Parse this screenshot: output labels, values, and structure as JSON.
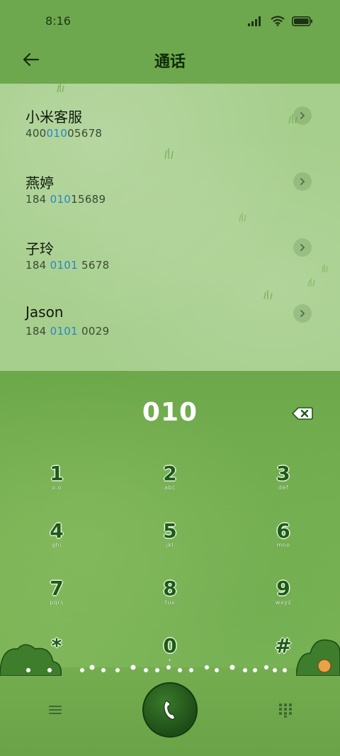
{
  "status_bar": {
    "time": "8:16"
  },
  "header": {
    "title": "通话"
  },
  "results": [
    {
      "name": "小米客服",
      "number_prefix": "400",
      "number_match": "010",
      "number_suffix": "05678"
    },
    {
      "name": "燕婷",
      "number_prefix": "184 ",
      "number_match": "010",
      "number_suffix": "15689"
    },
    {
      "name": "子玲",
      "number_prefix": "184 ",
      "number_match": "0101",
      "number_suffix": " 5678"
    },
    {
      "name": "Jason",
      "number_prefix": "184 ",
      "number_match": "0101",
      "number_suffix": " 0029"
    }
  ],
  "dialer": {
    "input_value": "010",
    "keys": [
      {
        "digit": "1",
        "letters": "o.o"
      },
      {
        "digit": "2",
        "letters": "abc"
      },
      {
        "digit": "3",
        "letters": "def"
      },
      {
        "digit": "4",
        "letters": "ghi"
      },
      {
        "digit": "5",
        "letters": "jkl"
      },
      {
        "digit": "6",
        "letters": "mno"
      },
      {
        "digit": "7",
        "letters": "pqrs"
      },
      {
        "digit": "8",
        "letters": "tuv"
      },
      {
        "digit": "9",
        "letters": "wxyz"
      },
      {
        "digit": "*",
        "letters": ""
      },
      {
        "digit": "0",
        "letters": "+"
      },
      {
        "digit": "#",
        "letters": ""
      }
    ]
  },
  "colors": {
    "highlight": "#2a86c8",
    "header_bg": "#6ea84e",
    "results_bg": "#a6ce8c",
    "call_button": "#1d4d17"
  },
  "icons": {
    "back": "arrow-left-icon",
    "detail": "chevron-right-icon",
    "backspace": "backspace-icon",
    "menu": "hamburger-menu-icon",
    "call": "phone-icon",
    "keypad": "dialpad-icon"
  }
}
